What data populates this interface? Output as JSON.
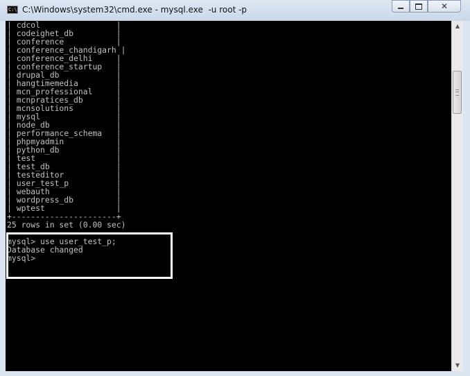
{
  "window": {
    "title": "C:\\Windows\\system32\\cmd.exe - mysql.exe  -u root -p",
    "icon": "cmd-icon",
    "icon_text": "C:\\",
    "controls": {
      "minimize": "minimize-icon",
      "maximize": "maximize-icon",
      "close": "close-icon",
      "close_glyph": "✕"
    }
  },
  "console": {
    "lines": [
      "| cdcol                |",
      "| codeighet_db         |",
      "| conference           |",
      "| conference_chandigarh |",
      "| conference_delhi     |",
      "| conference_startup   |",
      "| drupal_db            |",
      "| hangtimemedia        |",
      "| mcn_professional     |",
      "| mcnpratices_db       |",
      "| mcnsolutions         |",
      "| mysql                |",
      "| node_db              |",
      "| performance_schema   |",
      "| phpmyadmin           |",
      "| python_db            |",
      "| test                 |",
      "| test_db              |",
      "| testeditor           |",
      "| user_test_p          |",
      "| webauth              |",
      "| wordpress_db         |",
      "| wptest               |",
      "+----------------------+",
      "25 rows in set (0.00 sec)",
      "",
      "mysql> use user_test_p;",
      "Database changed",
      "mysql>"
    ],
    "colors": {
      "background": "#000000",
      "text": "#c0c0c0",
      "highlight_border": "#ffffff"
    }
  },
  "scrollbar": {
    "up_arrow": "▲",
    "down_arrow": "▼"
  }
}
